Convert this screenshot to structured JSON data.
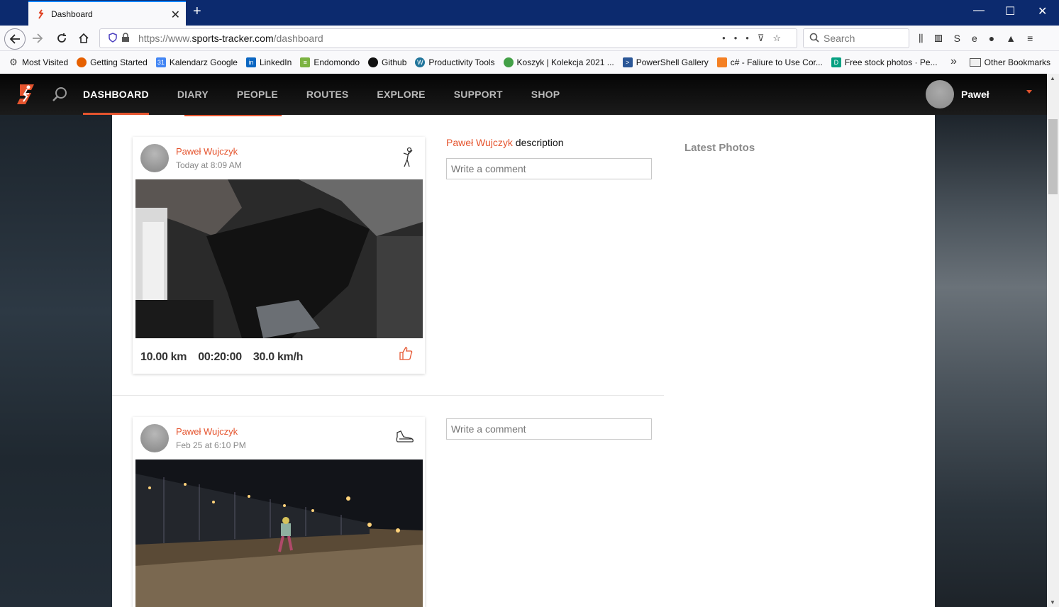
{
  "browser": {
    "tab_title": "Dashboard",
    "url_prefix": "https://www.",
    "url_domain": "sports-tracker.com",
    "url_path": "/dashboard",
    "search_placeholder": "Search",
    "bookmarks": [
      {
        "label": "Most Visited",
        "icon": "gear-icon",
        "color": "#555555"
      },
      {
        "label": "Getting Started",
        "icon": "firefox-icon",
        "color": "#e66000"
      },
      {
        "label": "Kalendarz Google",
        "icon": "calendar-icon",
        "color": "#4285f4"
      },
      {
        "label": "LinkedIn",
        "icon": "linkedin-icon",
        "color": "#0a66c2"
      },
      {
        "label": "Endomondo",
        "icon": "endomondo-icon",
        "color": "#7cb342"
      },
      {
        "label": "Github",
        "icon": "github-icon",
        "color": "#111111"
      },
      {
        "label": "Productivity Tools",
        "icon": "wordpress-icon",
        "color": "#21759b"
      },
      {
        "label": "Koszyk | Kolekcja 2021 ...",
        "icon": "leaf-icon",
        "color": "#43a047"
      },
      {
        "label": "PowerShell Gallery",
        "icon": "powershell-icon",
        "color": "#2b5797"
      },
      {
        "label": "c# - Faliure to Use Cor...",
        "icon": "stackoverflow-icon",
        "color": "#f48024"
      },
      {
        "label": "Free stock photos · Pe...",
        "icon": "pexels-icon",
        "color": "#05a081"
      }
    ],
    "other_bookmarks": "Other Bookmarks"
  },
  "site": {
    "nav": [
      "DASHBOARD",
      "DIARY",
      "PEOPLE",
      "ROUTES",
      "EXPLORE",
      "SUPPORT",
      "SHOP"
    ],
    "active_nav": "DASHBOARD",
    "user_name": "Paweł",
    "accent": "#e5542e"
  },
  "feed": [
    {
      "user": "Paweł Wujczyk",
      "date": "Today at 8:09 AM",
      "sport_icon": "fitness-class-icon",
      "distance": "10.00 km",
      "duration": "00:20:00",
      "speed": "30.0 km/h",
      "description_name": "Paweł Wujczyk",
      "description_text": " description",
      "comment_placeholder": "Write a comment"
    },
    {
      "user": "Paweł Wujczyk",
      "date": "Feb 25 at 6:10 PM",
      "sport_icon": "running-shoe-icon",
      "comment_placeholder": "Write a comment"
    }
  ],
  "sidebar": {
    "latest_photos": "Latest Photos"
  }
}
